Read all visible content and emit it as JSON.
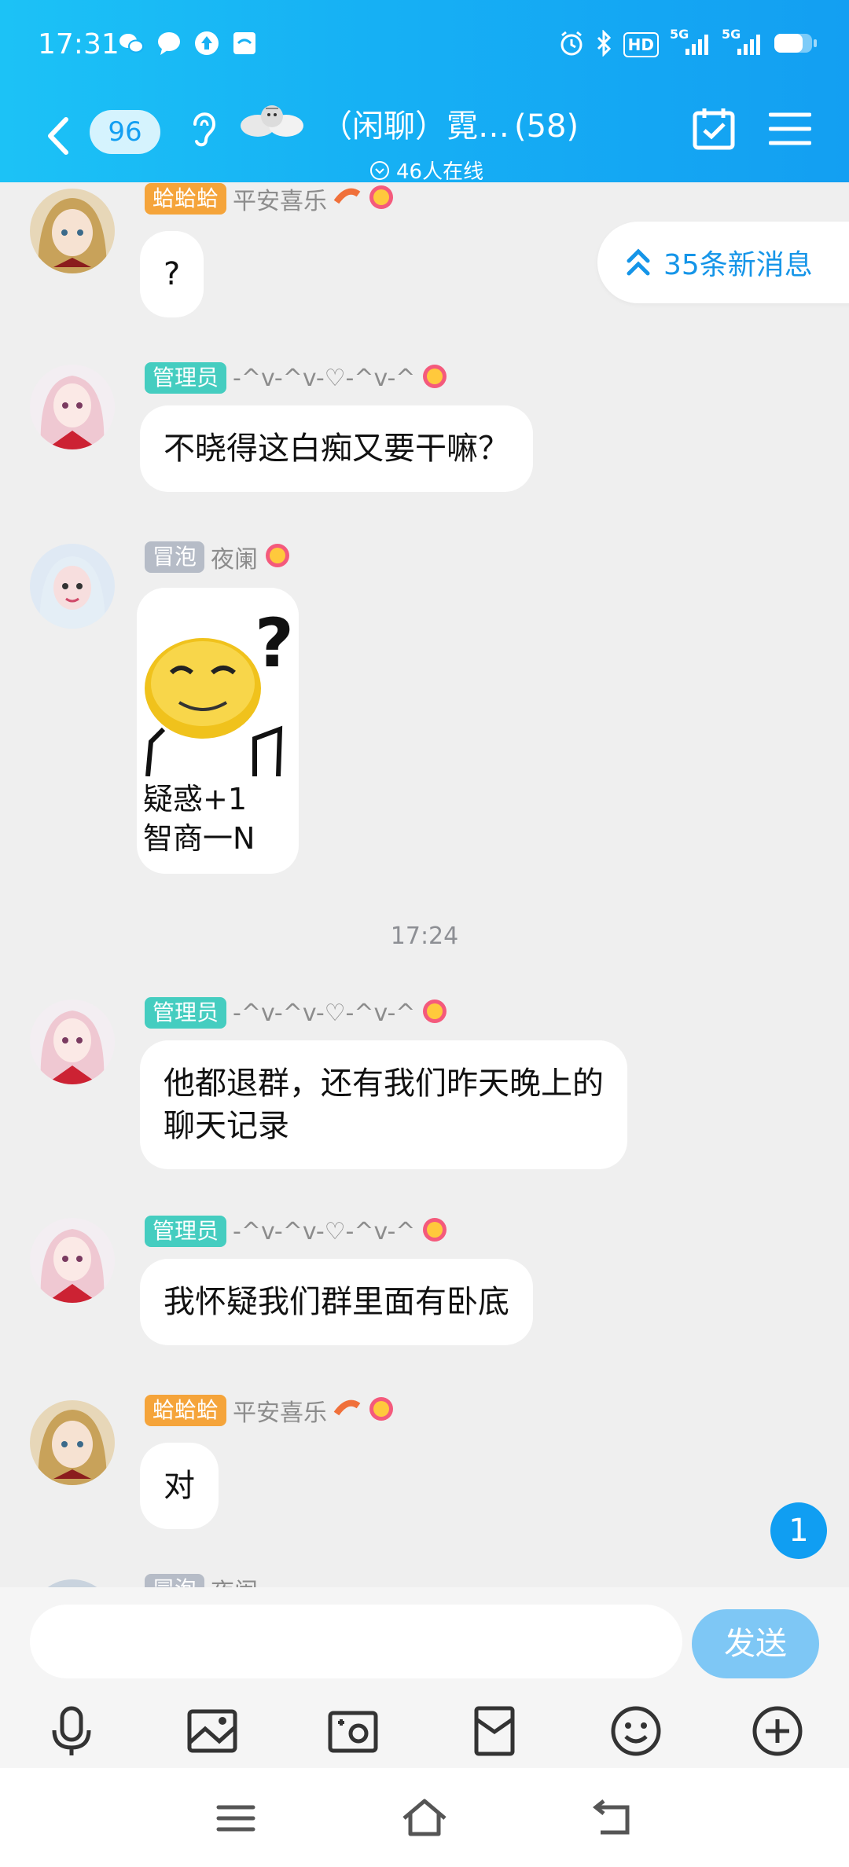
{
  "status": {
    "time": "17:31",
    "hd_label": "HD",
    "signal1": "5G",
    "signal2": "5G"
  },
  "nav": {
    "unread_count": "96",
    "group_name": "（闲聊）霓…",
    "member_count": "(58)",
    "online": "46人在线"
  },
  "new_messages_button": "35条新消息",
  "messages": [
    {
      "tag": "蛤蛤蛤",
      "nick": "平安喜乐",
      "text": "?"
    },
    {
      "tag": "管理员",
      "nick": "-^v-^v-♡-^v-^",
      "text": "不晓得这白痴又要干嘛？"
    },
    {
      "tag": "冒泡",
      "nick": "夜阑",
      "sticker_caption_1": "疑惑+1",
      "sticker_caption_2": "智商一N"
    },
    {
      "tag": "管理员",
      "nick": "-^v-^v-♡-^v-^",
      "text_line1": "他都退群，还有我们昨天晚上的",
      "text_line2": "聊天记录"
    },
    {
      "tag": "管理员",
      "nick": "-^v-^v-♡-^v-^",
      "text": "我怀疑我们群里面有卧底"
    },
    {
      "tag": "蛤蛤蛤",
      "nick": "平安喜乐",
      "text": "对"
    },
    {
      "tag": "冒泡",
      "nick": "夜阑"
    }
  ],
  "time_divider": "17:24",
  "unread_badge": "1",
  "composer": {
    "placeholder": "",
    "send_label": "发送"
  },
  "colors": {
    "header_start": "#1cc2f6",
    "header_end": "#139ff2",
    "accent": "#109ef2",
    "admin_tag": "#45cdc0",
    "title_tag": "#f5a43a",
    "bubble_tag": "#b6bcc7"
  },
  "icons": {
    "back": "chevron-left-icon",
    "ear": "ear-icon",
    "calendar": "calendar-check-icon",
    "menu": "hamburger-menu-icon",
    "voice": "microphone-icon",
    "image": "image-icon",
    "camera": "camera-icon",
    "red_packet": "red-packet-icon",
    "emoji": "emoji-icon",
    "more": "plus-circle-icon"
  }
}
